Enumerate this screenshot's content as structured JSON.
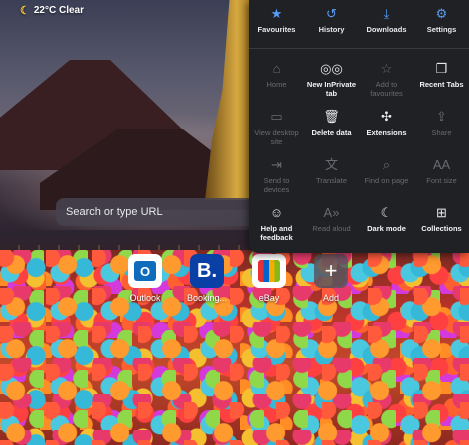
{
  "weather": {
    "icon": "moon-icon",
    "text": "22°C Clear"
  },
  "search": {
    "placeholder": "Search or type URL"
  },
  "tiles": [
    {
      "label": "Outlook",
      "icon": "outlook-icon"
    },
    {
      "label": "Booking...",
      "icon": "booking-icon",
      "glyph": "B."
    },
    {
      "label": "eBay",
      "icon": "ebay-icon"
    },
    {
      "label": "Add",
      "icon": "plus-icon",
      "glyph": "+"
    }
  ],
  "menu": {
    "top": [
      {
        "label": "Favourites",
        "icon": "star-icon",
        "glyph": "★"
      },
      {
        "label": "History",
        "icon": "history-icon",
        "glyph": "↺"
      },
      {
        "label": "Downloads",
        "icon": "download-icon",
        "glyph": "⤓"
      },
      {
        "label": "Settings",
        "icon": "gear-icon",
        "glyph": "⚙"
      }
    ],
    "grid": [
      {
        "label": "Home",
        "icon": "home-icon",
        "glyph": "⌂",
        "enabled": false
      },
      {
        "label": "New InPrivate tab",
        "icon": "inprivate-icon",
        "glyph": "◎◎",
        "enabled": true
      },
      {
        "label": "Add to favourites",
        "icon": "star-plus-icon",
        "glyph": "☆",
        "enabled": false
      },
      {
        "label": "Recent Tabs",
        "icon": "recent-tabs-icon",
        "glyph": "❐",
        "enabled": true
      },
      {
        "label": "View desktop site",
        "icon": "desktop-icon",
        "glyph": "▭",
        "enabled": false
      },
      {
        "label": "Delete data",
        "icon": "trash-icon",
        "glyph": "🗑",
        "enabled": true
      },
      {
        "label": "Extensions",
        "icon": "puzzle-icon",
        "glyph": "✣",
        "enabled": true
      },
      {
        "label": "Share",
        "icon": "share-icon",
        "glyph": "⇪",
        "enabled": false
      },
      {
        "label": "Send to devices",
        "icon": "send-devices-icon",
        "glyph": "⇥",
        "enabled": false
      },
      {
        "label": "Translate",
        "icon": "translate-icon",
        "glyph": "文",
        "enabled": false
      },
      {
        "label": "Find on page",
        "icon": "find-icon",
        "glyph": "⌕",
        "enabled": false
      },
      {
        "label": "Font size",
        "icon": "font-size-icon",
        "glyph": "AA",
        "enabled": false
      },
      {
        "label": "Help and feedback",
        "icon": "help-icon",
        "glyph": "☺",
        "enabled": true
      },
      {
        "label": "Read aloud",
        "icon": "read-aloud-icon",
        "glyph": "A»",
        "enabled": false
      },
      {
        "label": "Dark mode",
        "icon": "moon-icon",
        "glyph": "☾",
        "enabled": true
      },
      {
        "label": "Collections",
        "icon": "collections-icon",
        "glyph": "⊞",
        "enabled": true
      }
    ]
  },
  "colors": {
    "menu_bg": "#202124",
    "accent": "#5a9cf5"
  }
}
